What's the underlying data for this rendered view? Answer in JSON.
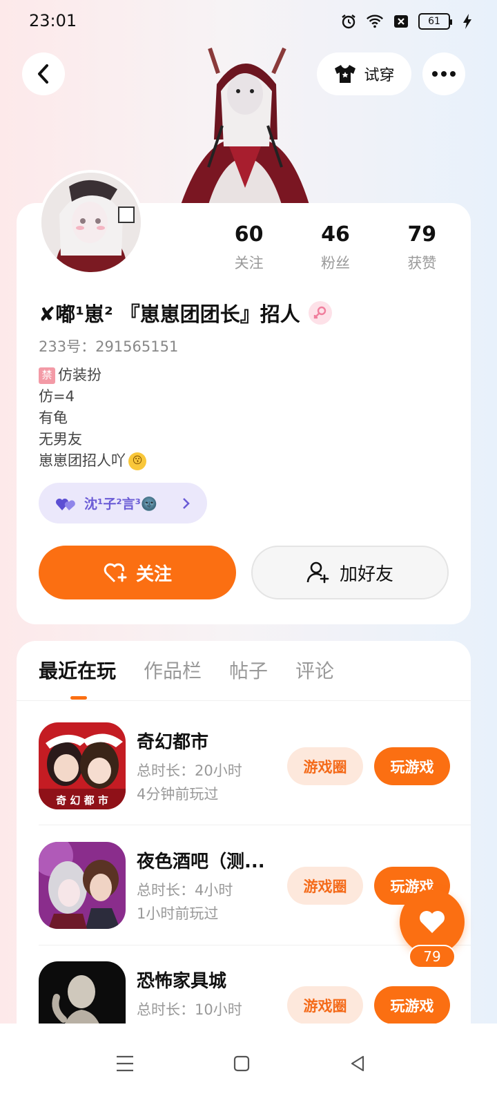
{
  "status_bar": {
    "time": "23:01",
    "battery": "61",
    "icons": [
      "alarm-icon",
      "wifi-icon",
      "no-sim-icon",
      "battery-icon",
      "charging-icon"
    ]
  },
  "header": {
    "try_on_label": "试穿"
  },
  "profile": {
    "stats": [
      {
        "value": "60",
        "label": "关注"
      },
      {
        "value": "46",
        "label": "粉丝"
      },
      {
        "value": "79",
        "label": "获赞"
      }
    ],
    "username": "✘嘟¹崽² 『崽崽团团长』招人",
    "gender": "female",
    "uid": "233号：291565151",
    "bio_tag": "禁",
    "bio": [
      "仿装扮",
      "仿=4",
      "有龟",
      "无男友",
      "崽崽团招人吖"
    ],
    "couple_name": "沈¹子²言³🌚",
    "follow_label": "关注",
    "add_friend_label": "加好友"
  },
  "tabs": [
    {
      "label": "最近在玩",
      "active": true
    },
    {
      "label": "作品栏",
      "active": false
    },
    {
      "label": "帖子",
      "active": false
    },
    {
      "label": "评论",
      "active": false
    }
  ],
  "games": [
    {
      "name": "奇幻都市",
      "total": "总时长：20小时",
      "last": "4分钟前玩过",
      "icon_text": "奇 幻 都 市",
      "circle_label": "游戏圈",
      "play_label": "玩游戏"
    },
    {
      "name": "夜色酒吧（测...",
      "total": "总时长：4小时",
      "last": "1小时前玩过",
      "circle_label": "游戏圈",
      "play_label": "玩游戏"
    },
    {
      "name": "恐怖家具城",
      "total": "总时长：10小时",
      "last": "",
      "circle_label": "游戏圈",
      "play_label": "玩游戏"
    }
  ],
  "fab": {
    "like_count": "79"
  },
  "colors": {
    "accent": "#fb6f12",
    "accent_light": "#fde8dc",
    "couple": "#6a5bd6"
  }
}
